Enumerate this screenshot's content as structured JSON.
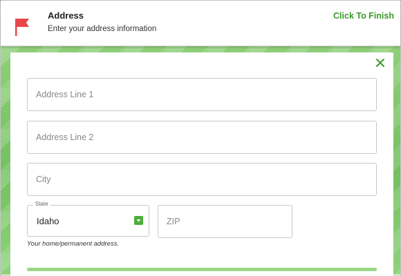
{
  "header": {
    "title": "Address",
    "subtitle": "Enter your address information",
    "finish_label": "Click To Finish",
    "flag_icon": "flag-icon",
    "flag_color": "#e8474b"
  },
  "form": {
    "address_line1": {
      "placeholder": "Address Line 1",
      "value": ""
    },
    "address_line2": {
      "placeholder": "Address Line 2",
      "value": ""
    },
    "city": {
      "placeholder": "City",
      "value": ""
    },
    "state": {
      "label": "State",
      "value": "Idaho"
    },
    "zip": {
      "placeholder": "ZIP",
      "value": ""
    },
    "helper": "Your home/permanent address.",
    "close_icon": "close-icon"
  },
  "colors": {
    "accent": "#3a9a2a",
    "background_green": "#7cc46a"
  }
}
